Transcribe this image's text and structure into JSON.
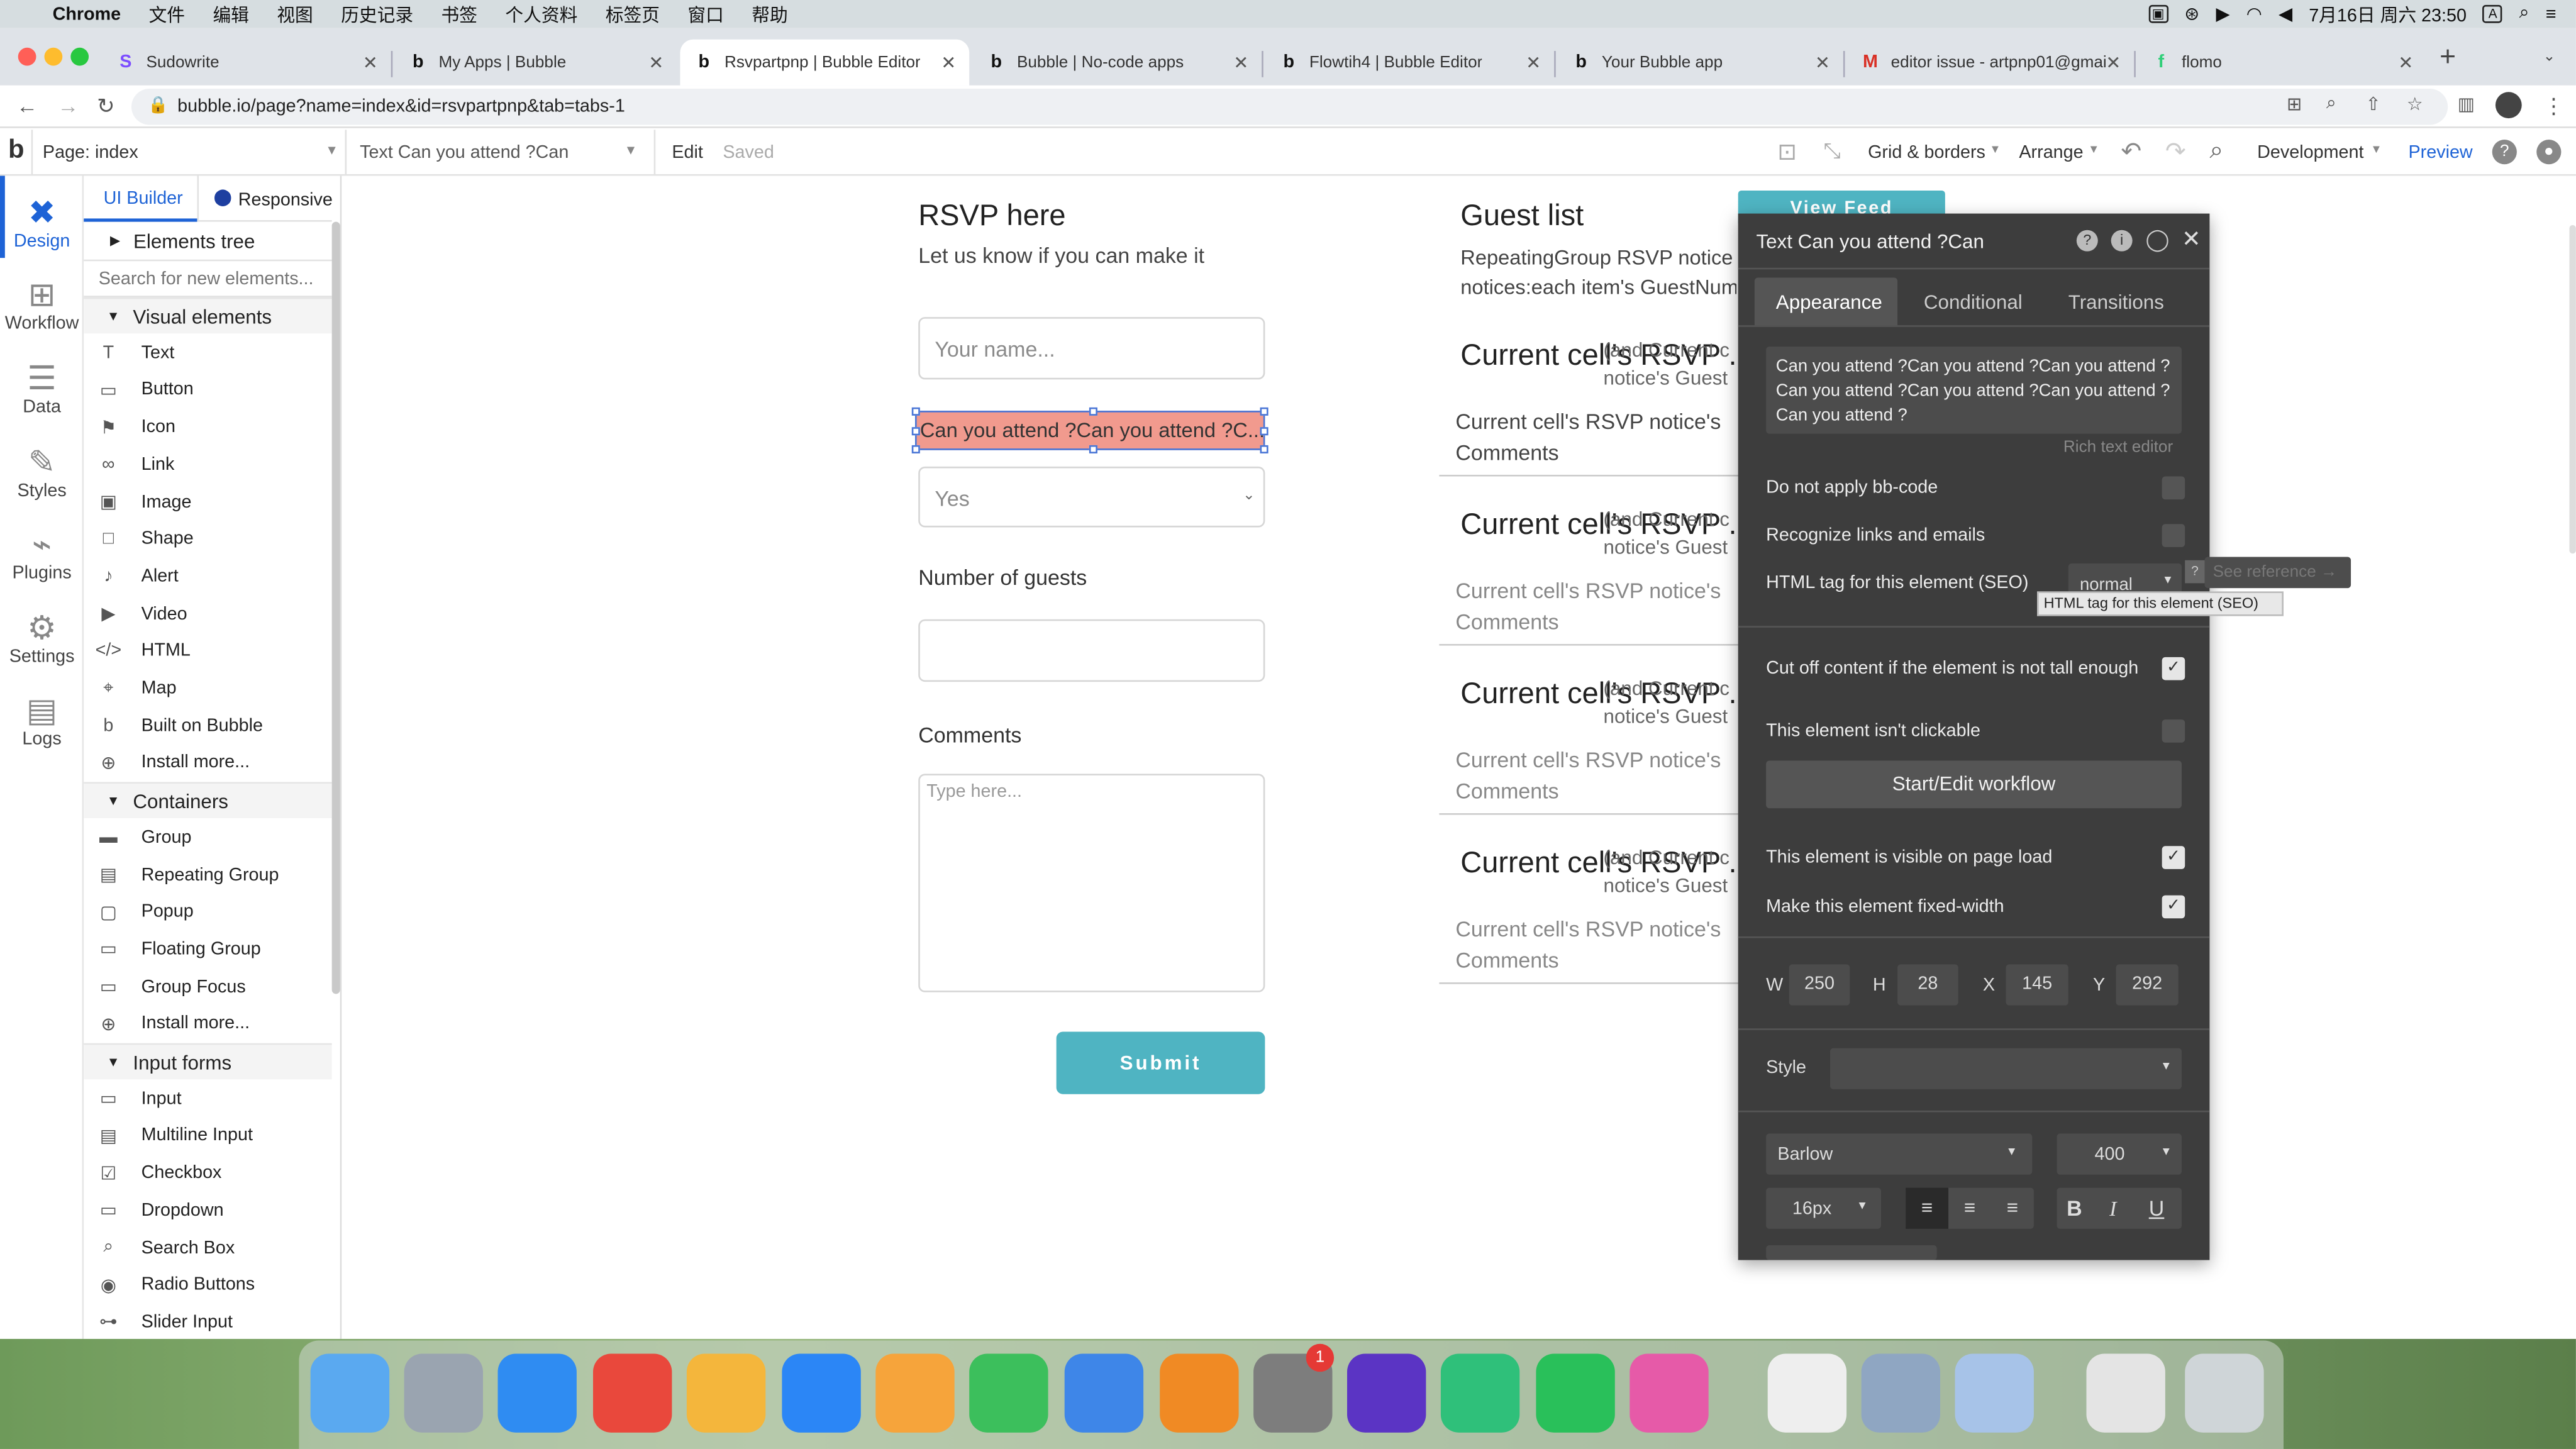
{
  "menubar": {
    "app": "Chrome",
    "items": [
      "文件",
      "编辑",
      "视图",
      "历史记录",
      "书签",
      "个人资料",
      "标签页",
      "窗口",
      "帮助"
    ],
    "datetime": "7月16日 周六  23:50"
  },
  "tabs": [
    {
      "title": "Sudowrite",
      "fav": "S",
      "favcolor": "#7c4dff"
    },
    {
      "title": "My Apps | Bubble",
      "fav": "b",
      "favcolor": "#111"
    },
    {
      "title": "Rsvpartpnp | Bubble Editor",
      "fav": "b",
      "favcolor": "#111",
      "active": true
    },
    {
      "title": "Bubble | No-code apps",
      "fav": "b",
      "favcolor": "#111"
    },
    {
      "title": "Flowtih4 | Bubble Editor",
      "fav": "b",
      "favcolor": "#111"
    },
    {
      "title": "Your Bubble app",
      "fav": "b",
      "favcolor": "#111"
    },
    {
      "title": "editor issue - artpnp01@gmai",
      "fav": "M",
      "favcolor": "#d93025"
    },
    {
      "title": "flomo",
      "fav": "f",
      "favcolor": "#30cf79"
    }
  ],
  "address": {
    "url": "bubble.io/page?name=index&id=rsvpartpnp&tab=tabs-1"
  },
  "topbar": {
    "page": "Page: index",
    "element": "Text Can you attend ?Can",
    "edit": "Edit",
    "saved": "Saved",
    "grid": "Grid & borders",
    "arrange": "Arrange",
    "env": "Development",
    "preview": "Preview"
  },
  "rail": [
    "Design",
    "Workflow",
    "Data",
    "Styles",
    "Plugins",
    "Settings",
    "Logs"
  ],
  "panel": {
    "tab_ui": "UI Builder",
    "tab_resp": "Responsive",
    "tree": "Elements tree",
    "search_ph": "Search for new elements...",
    "sec_visual": "Visual elements",
    "visual": [
      {
        "l": "Text",
        "i": "T"
      },
      {
        "l": "Button",
        "i": "▭"
      },
      {
        "l": "Icon",
        "i": "⚑"
      },
      {
        "l": "Link",
        "i": "∞"
      },
      {
        "l": "Image",
        "i": "▣"
      },
      {
        "l": "Shape",
        "i": "□"
      },
      {
        "l": "Alert",
        "i": "♪"
      },
      {
        "l": "Video",
        "i": "▶"
      },
      {
        "l": "HTML",
        "i": "</>"
      },
      {
        "l": "Map",
        "i": "⌖"
      },
      {
        "l": "Built on Bubble",
        "i": "b"
      },
      {
        "l": "Install more...",
        "i": "⊕"
      }
    ],
    "sec_containers": "Containers",
    "containers": [
      {
        "l": "Group",
        "i": "▬"
      },
      {
        "l": "Repeating Group",
        "i": "▤"
      },
      {
        "l": "Popup",
        "i": "▢"
      },
      {
        "l": "Floating Group",
        "i": "▭"
      },
      {
        "l": "Group Focus",
        "i": "▭"
      },
      {
        "l": "Install more...",
        "i": "⊕"
      }
    ],
    "sec_inputs": "Input forms",
    "inputs": [
      {
        "l": "Input",
        "i": "▭"
      },
      {
        "l": "Multiline Input",
        "i": "▤"
      },
      {
        "l": "Checkbox",
        "i": "☑"
      },
      {
        "l": "Dropdown",
        "i": "▭"
      },
      {
        "l": "Search Box",
        "i": "⌕"
      },
      {
        "l": "Radio Buttons",
        "i": "◉"
      },
      {
        "l": "Slider Input",
        "i": "⊶"
      }
    ]
  },
  "canvas": {
    "rsvp_title": "RSVP here",
    "rsvp_sub": "Let us know if you can make it",
    "name_ph": "Your name...",
    "selected_text": "Can you attend ?Can you attend ?C...",
    "dropdown_val": "Yes",
    "guests_label": "Number of guests",
    "comments_label": "Comments",
    "comments_ph": "Type here...",
    "submit": "Submit",
    "guest_title": "Guest list",
    "guest_line1": "RepeatingGroup RSVP notice",
    "guest_line2": "notices:each item's GuestNum",
    "view_feed": "View Feed",
    "cells": [
      {
        "t": "Current cell's RSVP ...",
        "o1": "(and Current c",
        "o2": "notice's Guest",
        "c1": "Current cell's RSVP notice's",
        "c2": "Comments"
      },
      {
        "t": "Current cell's RSVP ...",
        "o1": "(and Current c",
        "o2": "notice's Guest",
        "c1": "Current cell's RSVP notice's",
        "c2": "Comments"
      },
      {
        "t": "Current cell's RSVP ...",
        "o1": "(and Current c",
        "o2": "notice's Guest",
        "c1": "Current cell's RSVP notice's",
        "c2": "Comments"
      },
      {
        "t": "Current cell's RSVP ...",
        "o1": "(and Current c",
        "o2": "notice's Guest",
        "c1": "Current cell's RSVP notice's",
        "c2": "Comments"
      }
    ]
  },
  "prop": {
    "title": "Text Can you attend ?Can",
    "tabs": [
      "Appearance",
      "Conditional",
      "Transitions"
    ],
    "content": "Can you attend ?Can you attend ?Can you attend ? Can you attend ?Can you attend ?Can you attend ? Can you attend ?",
    "rich": "Rich text editor",
    "bbcode": "Do not apply bb-code",
    "links": "Recognize links and emails",
    "seo": "HTML tag for this element (SEO)",
    "seo_val": "normal",
    "see_ref": "See reference →",
    "tooltip": "HTML tag for this element (SEO)",
    "cutoff": "Cut off content if the element is not tall enough",
    "notclick": "This element isn't clickable",
    "workflow": "Start/Edit workflow",
    "visible": "This element is visible on page load",
    "fixedw": "Make this element fixed-width",
    "W": "250",
    "H": "28",
    "X": "145",
    "Y": "292",
    "style": "Style",
    "font": "Barlow",
    "weight": "400",
    "size": "16px"
  }
}
